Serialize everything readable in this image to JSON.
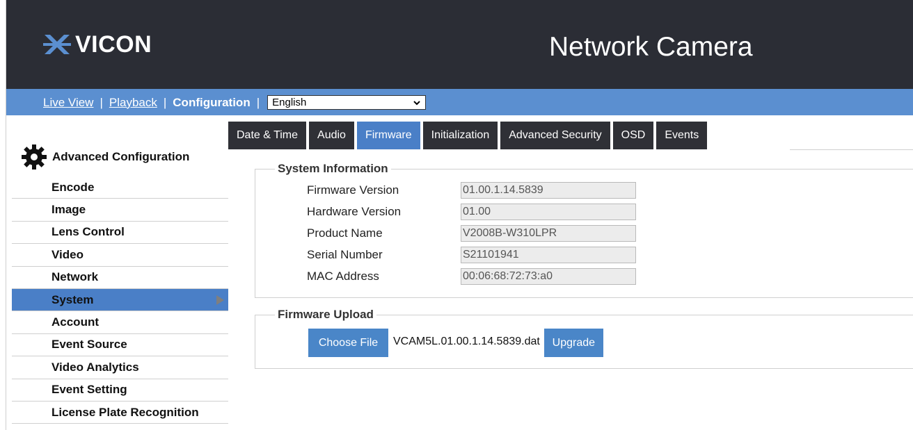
{
  "header": {
    "logo_text": "VICON",
    "product_title": "Network Camera"
  },
  "nav": {
    "live_view": "Live View",
    "playback": "Playback",
    "configuration": "Configuration",
    "separator": "|",
    "language": "English"
  },
  "sidebar": {
    "title": "Advanced Configuration",
    "items": [
      {
        "label": "Encode"
      },
      {
        "label": "Image"
      },
      {
        "label": "Lens Control"
      },
      {
        "label": "Video"
      },
      {
        "label": "Network"
      },
      {
        "label": "System",
        "active": true
      },
      {
        "label": "Account"
      },
      {
        "label": "Event Source"
      },
      {
        "label": "Video Analytics"
      },
      {
        "label": "Event Setting"
      },
      {
        "label": "License Plate Recognition"
      }
    ]
  },
  "tabs": [
    {
      "label": "Date & Time"
    },
    {
      "label": "Audio"
    },
    {
      "label": "Firmware",
      "active": true
    },
    {
      "label": "Initialization"
    },
    {
      "label": "Advanced Security"
    },
    {
      "label": "OSD"
    },
    {
      "label": "Events"
    }
  ],
  "system_info": {
    "legend": "System Information",
    "rows": [
      {
        "label": "Firmware Version",
        "value": "01.00.1.14.5839"
      },
      {
        "label": "Hardware Version",
        "value": "01.00"
      },
      {
        "label": "Product Name",
        "value": "V2008B-W310LPR"
      },
      {
        "label": "Serial Number",
        "value": "S21101941"
      },
      {
        "label": "MAC Address",
        "value": "00:06:68:72:73:a0"
      }
    ]
  },
  "firmware_upload": {
    "legend": "Firmware Upload",
    "choose_file_label": "Choose File",
    "file_name": "VCAM5L.01.00.1.14.5839.dat",
    "upgrade_label": "Upgrade"
  },
  "colors": {
    "header_bg": "#2b2d35",
    "nav_bg": "#5b8fd0",
    "accent": "#4a7fc7",
    "tab_bg": "#2f3036"
  }
}
